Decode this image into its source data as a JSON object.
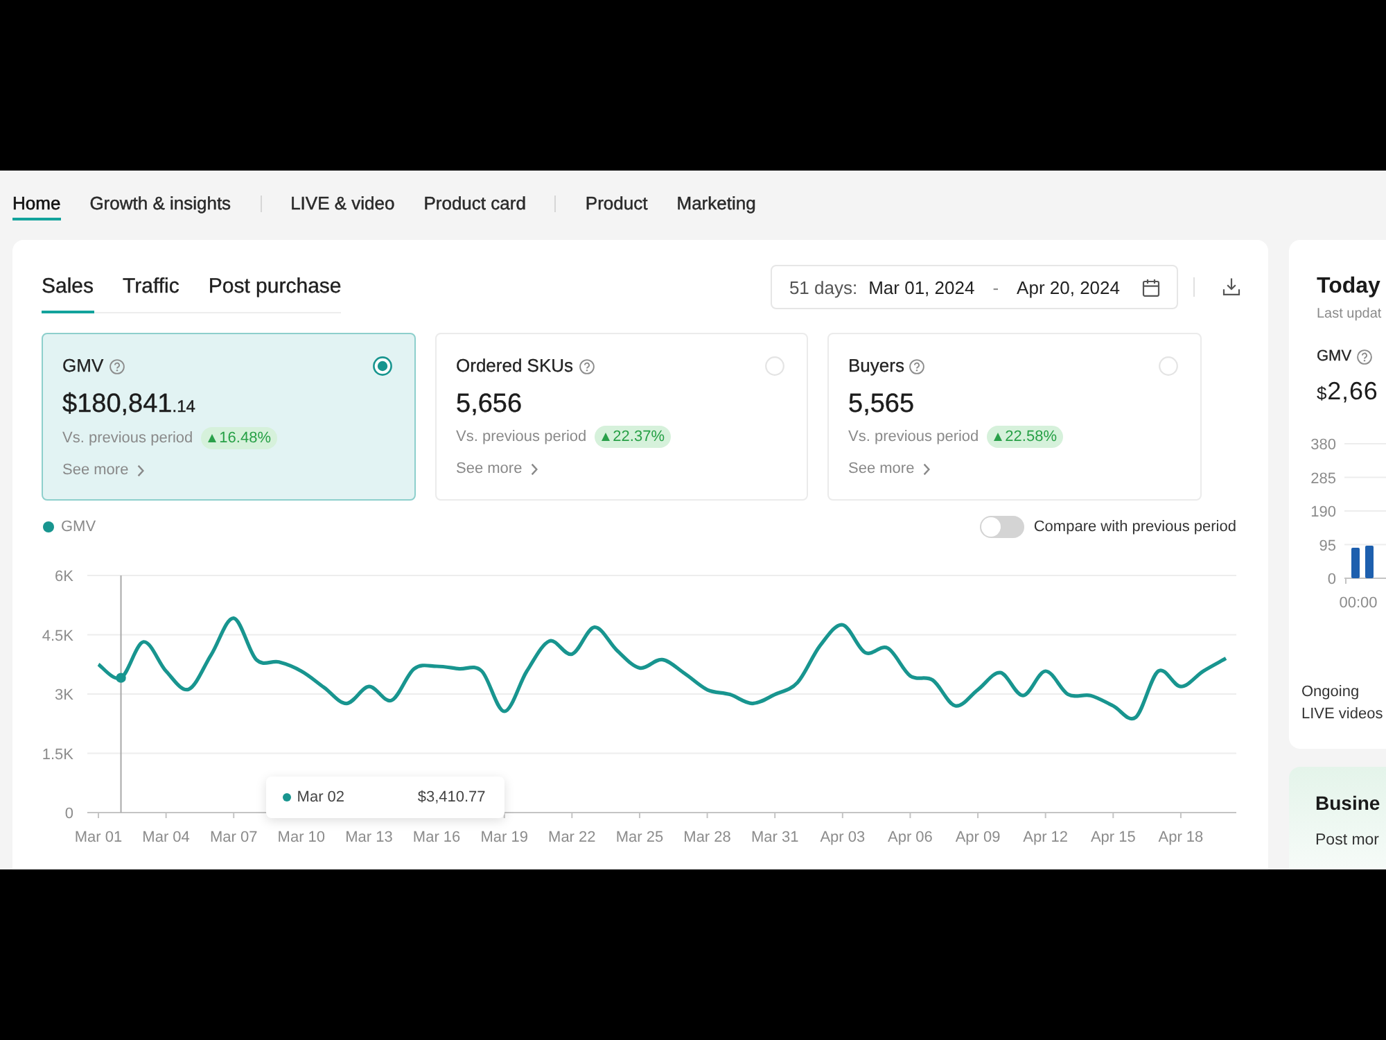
{
  "nav": [
    {
      "tabs": [
        {
          "label": "Home",
          "selected": true
        },
        {
          "label": "Growth & insights",
          "selected": false
        }
      ]
    },
    {
      "tabs": [
        {
          "label": "LIVE & video",
          "selected": false
        },
        {
          "label": "Product card",
          "selected": false
        }
      ]
    },
    {
      "tabs": [
        {
          "label": "Product",
          "selected": false
        },
        {
          "label": "Marketing",
          "selected": false
        }
      ]
    }
  ],
  "main": {
    "tabs": [
      {
        "label": "Sales",
        "selected": true
      },
      {
        "label": "Traffic",
        "selected": false
      },
      {
        "label": "Post purchase",
        "selected": false
      }
    ],
    "date_range": {
      "label": "51 days:",
      "start": "Mar 01, 2024",
      "separator": "-",
      "end": "Apr 20, 2024"
    },
    "metrics": [
      {
        "title": "GMV",
        "value": "$180,841",
        "decimals": ".14",
        "comparison": "Vs. previous period",
        "increased": true,
        "change": "16.48%",
        "link": "See more",
        "selected": true
      },
      {
        "title": "Ordered SKUs",
        "value": "5,656",
        "comparison": "Vs. previous period",
        "increased": true,
        "change": "22.37%",
        "link": "See more",
        "selected": false
      },
      {
        "title": "Buyers",
        "value": "5,565",
        "comparison": "Vs. previous period",
        "increased": true,
        "change": "22.58%",
        "link": "See more",
        "selected": false
      }
    ],
    "compare_toggle": {
      "label": "Compare with previous period",
      "on": false
    },
    "chart": {
      "tooltip": {
        "date": "Mar 02"
      },
      "chart_data": {
        "type": "line",
        "grid": true,
        "categories": [
          "Mar 01",
          null,
          null,
          "Mar 04",
          null,
          null,
          "Mar 07",
          null,
          null,
          "Mar 10",
          null,
          null,
          "Mar 13",
          null,
          null,
          "Mar 16",
          null,
          null,
          "Mar 19",
          null,
          null,
          "Mar 22",
          null,
          null,
          "Mar 25",
          null,
          null,
          "Mar 28",
          null,
          null,
          "Mar 31",
          null,
          null,
          "Apr 03",
          null,
          null,
          "Apr 06",
          null,
          null,
          "Apr 09",
          null,
          null,
          "Apr 12",
          null,
          null,
          "Apr 15",
          null,
          null,
          "Apr 18",
          null,
          null
        ],
        "ylim": [
          0,
          6000
        ],
        "yticks": [
          {
            "value": 0,
            "label": "0"
          },
          {
            "value": 1500,
            "label": "1.5K"
          },
          {
            "value": 3000,
            "label": "3K"
          },
          {
            "value": 4500,
            "label": "4.5K"
          },
          {
            "value": 6000,
            "label": "6K"
          }
        ],
        "series": [
          {
            "name": "GMV",
            "color": "#18958f",
            "values": [
              3750,
              3410,
              4320,
              3580,
              3120,
              3990,
              4920,
              3870,
              3810,
              3580,
              3170,
              2760,
              3190,
              2840,
              3640,
              3700,
              3640,
              3580,
              2560,
              3580,
              4340,
              4010,
              4690,
              4100,
              3660,
              3870,
              3520,
              3110,
              2990,
              2760,
              2990,
              3290,
              4220,
              4750,
              4050,
              4160,
              3460,
              3350,
              2700,
              3110,
              3540,
              2960,
              3580,
              2990,
              2960,
              2700,
              2410,
              3580,
              3190,
              3580,
              3900
            ]
          }
        ],
        "annotations": [
          "$3,410.77"
        ]
      }
    }
  },
  "today_panel": {
    "title": "Today",
    "subtitle": "Last updat",
    "metric": "GMV",
    "value_currency": "$",
    "value": "2,66",
    "chart_data": {
      "type": "bar",
      "grid": true,
      "categories": [
        "00:00",
        null
      ],
      "ylim": [
        0,
        380
      ],
      "yticks": [
        {
          "value": 0,
          "label": "0"
        },
        {
          "value": 95,
          "label": "95"
        },
        {
          "value": 190,
          "label": "190"
        },
        {
          "value": 285,
          "label": "285"
        },
        {
          "value": 380,
          "label": "380"
        }
      ],
      "series": [
        {
          "color": "#1d5fae",
          "values": [
            86,
            92
          ]
        }
      ]
    },
    "live_label": "Ongoing LIVE videos"
  },
  "business_panel": {
    "title": "Busine",
    "text": "Post mor"
  }
}
